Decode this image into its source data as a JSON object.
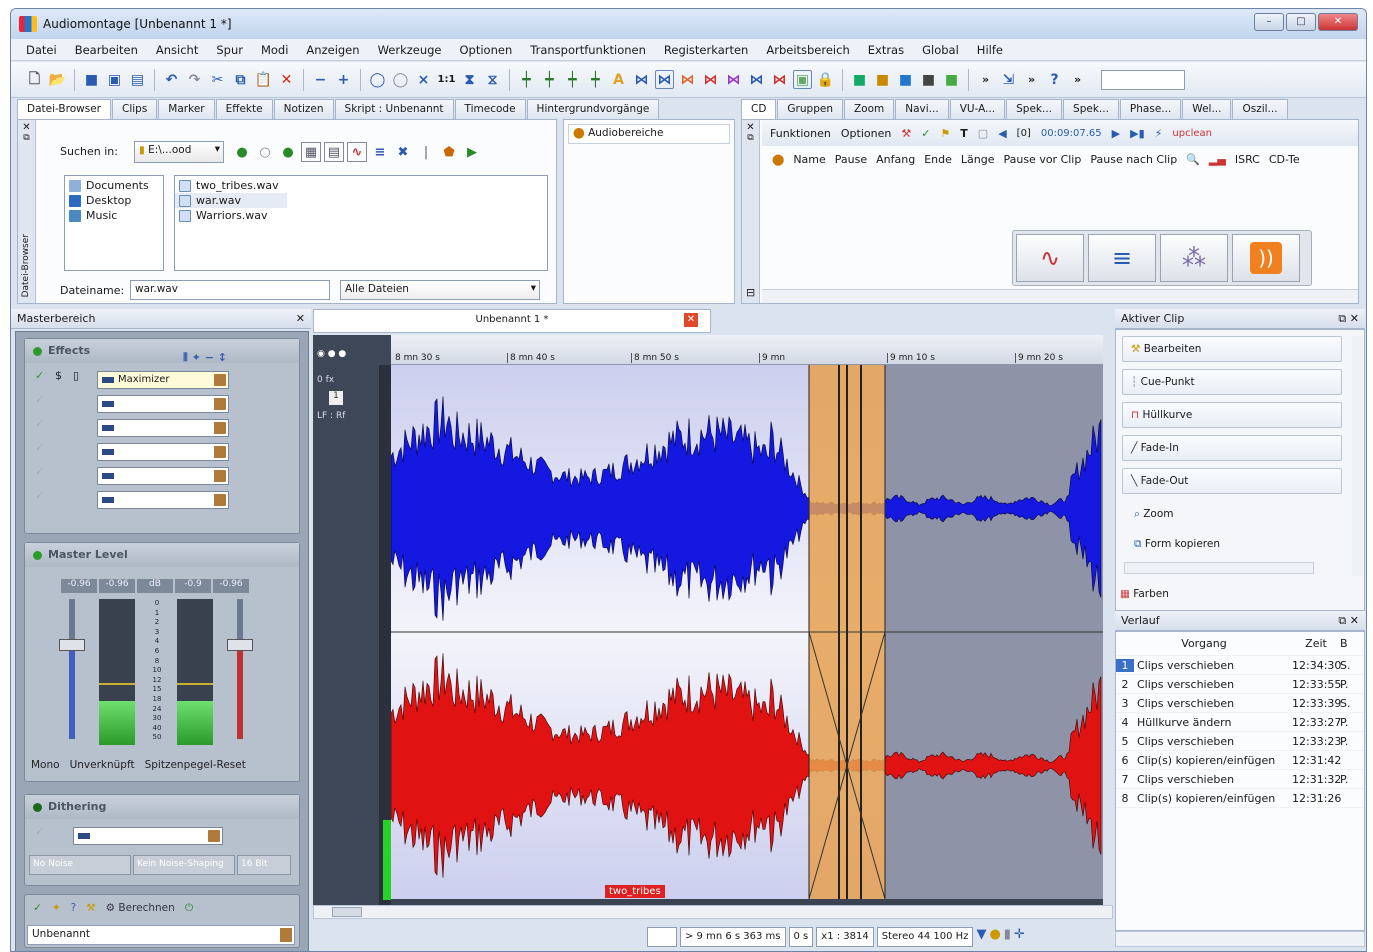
{
  "window": {
    "title": "Audiomontage [Unbenannt 1 *]",
    "buttons": [
      "–",
      "□",
      "✕"
    ]
  },
  "menu": [
    "Datei",
    "Bearbeiten",
    "Ansicht",
    "Spur",
    "Modi",
    "Anzeigen",
    "Werkzeuge",
    "Optionen",
    "Transportfunktionen",
    "Registerkarten",
    "Arbeitsbereich",
    "Extras",
    "Global",
    "Hilfe"
  ],
  "toolbar": {
    "icons": [
      "new-icon",
      "open-icon",
      "save-icon",
      "save-as-icon",
      "save-all-icon",
      "undo-icon",
      "redo-icon",
      "cut-icon",
      "copy-icon",
      "paste-icon",
      "delete-icon",
      "minus-icon",
      "plus-icon",
      "loop-icon",
      "stop-icon",
      "trim-icon",
      "ratio-icon",
      "hourglass-icon",
      "hourglass2-icon"
    ],
    "ratio_label": "1:1"
  },
  "left_tabs": [
    "Datei-Browser",
    "Clips",
    "Marker",
    "Effekte",
    "Notizen",
    "Skript : Unbenannt",
    "Timecode",
    "Hintergrundvorgänge"
  ],
  "browser": {
    "search_label": "Suchen in:",
    "search_path": "E:\\...ood",
    "folders": [
      "Documents",
      "Desktop",
      "Music"
    ],
    "files": [
      "two_tribes.wav",
      "war.wav",
      "Warriors.wav"
    ],
    "filename_label": "Dateiname:",
    "filename_value": "war.wav",
    "filter_value": "Alle Dateien",
    "side_label": "Datei-Browser"
  },
  "bg_panel": {
    "item": "Audiobereiche"
  },
  "right_tabs": [
    "CD",
    "Gruppen",
    "Zoom",
    "Navi...",
    "VU-A...",
    "Spek...",
    "Spek...",
    "Phase...",
    "Wel...",
    "Oszil..."
  ],
  "cd": {
    "functions": "Funktionen",
    "options": "Optionen",
    "time_prefix": "[0]",
    "time_value": "00:09:07.65",
    "upclean": "upclean",
    "columns": [
      "Name",
      "Pause",
      "Anfang",
      "Ende",
      "Länge",
      "Pause vor Clip",
      "Pause nach Clip",
      "ISRC",
      "CD-Te"
    ]
  },
  "master": {
    "title": "Masterbereich",
    "effects_title": "Effects",
    "effects": [
      "Maximizer",
      "",
      "",
      "",
      "",
      ""
    ],
    "level_title": "Master Level",
    "level_values": [
      "-0.96",
      "-0.96",
      "dB",
      "-0.9",
      "-0.96"
    ],
    "scale": [
      "0",
      "1",
      "2",
      "3",
      "4",
      "6",
      "8",
      "10",
      "12",
      "15",
      "18",
      "24",
      "30",
      "40",
      "50"
    ],
    "level_buttons": [
      "Mono",
      "Unverknüpft",
      "Spitzenpegel-Reset"
    ],
    "dither_title": "Dithering",
    "dither_options": [
      "No Noise",
      "Kein Noise-Shaping",
      "16 Bit"
    ],
    "render_label": "Berechnen",
    "preset_value": "Unbenannt"
  },
  "montage": {
    "tab": "Unbenannt 1 *",
    "ruler": [
      "8 mn 30 s",
      "8 mn 40 s",
      "8 mn 50 s",
      "9 mn",
      "9 mn 10 s",
      "9 mn 20 s"
    ],
    "track_labels": [
      "0 fx",
      "1",
      "LF : Rf"
    ],
    "clip_name": "two_tribes",
    "status": [
      "> 9 mn 6 s 363 ms",
      "0 s",
      "x1 : 3814",
      "Stereo 44 100 Hz"
    ]
  },
  "active_clip": {
    "title": "Aktiver Clip",
    "buttons": [
      "Bearbeiten",
      "Cue-Punkt",
      "Hüllkurve",
      "Fade-In",
      "Fade-Out"
    ],
    "links": [
      "Zoom",
      "Form kopieren"
    ],
    "colors": "Farben"
  },
  "history": {
    "title": "Verlauf",
    "columns": [
      "Vorgang",
      "Zeit",
      "B"
    ],
    "rows": [
      {
        "n": "1",
        "op": "Clips verschieben",
        "time": "12:34:30",
        "b": "S."
      },
      {
        "n": "2",
        "op": "Clips verschieben",
        "time": "12:33:55",
        "b": "P."
      },
      {
        "n": "3",
        "op": "Clips verschieben",
        "time": "12:33:39",
        "b": "S."
      },
      {
        "n": "4",
        "op": "Hüllkurve ändern",
        "time": "12:33:27",
        "b": "P."
      },
      {
        "n": "5",
        "op": "Clips verschieben",
        "time": "12:33:23",
        "b": "P."
      },
      {
        "n": "6",
        "op": "Clip(s) kopieren/einfügen",
        "time": "12:31:42",
        "b": ""
      },
      {
        "n": "7",
        "op": "Clips verschieben",
        "time": "12:31:32",
        "b": "P."
      },
      {
        "n": "8",
        "op": "Clip(s) kopieren/einfügen",
        "time": "12:31:26",
        "b": ""
      }
    ]
  },
  "colors": {
    "wave_top": "#1418e0",
    "wave_bottom": "#e01212",
    "selection": "#e6a050",
    "accent": "#2b5aa8"
  }
}
